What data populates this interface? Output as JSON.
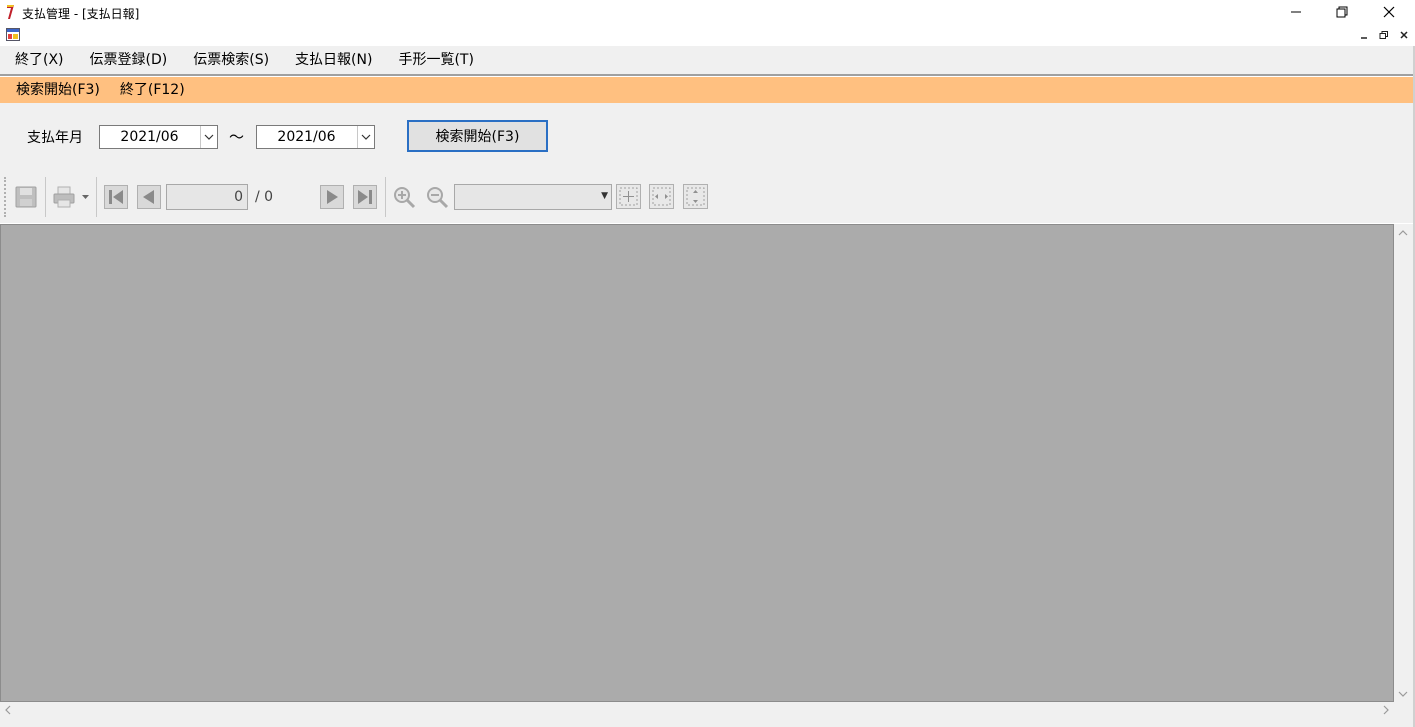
{
  "window": {
    "title": "支払管理 - [支払日報]",
    "controls": {
      "minimize": "—",
      "maximize": "❐",
      "close": "✕"
    }
  },
  "mdi": {
    "minimize": "_",
    "restore": "🗗",
    "close": "✕"
  },
  "menu": {
    "items": [
      {
        "label": "終了(X)"
      },
      {
        "label": "伝票登録(D)"
      },
      {
        "label": "伝票検索(S)"
      },
      {
        "label": "支払日報(N)"
      },
      {
        "label": "手形一覧(T)"
      }
    ]
  },
  "fkeys": {
    "items": [
      {
        "label": "検索開始(F3)"
      },
      {
        "label": "終了(F12)"
      }
    ],
    "background": "#ffc080"
  },
  "criteria": {
    "label": "支払年月",
    "from_value": "2021/06",
    "separator": "～",
    "to_value": "2021/06",
    "search_button": "検索開始(F3)",
    "accent": "#2a6fc4"
  },
  "toolbar": {
    "current_page": "0",
    "total_pages": "/ 0",
    "zoom_value": "",
    "icons": [
      "save-icon",
      "print-icon",
      "first-page-icon",
      "prev-page-icon",
      "next-page-icon",
      "last-page-icon",
      "zoom-in-icon",
      "zoom-out-icon",
      "fit-page-icon",
      "fit-width-icon",
      "fit-height-icon"
    ]
  },
  "viewer": {
    "background": "#ababab"
  }
}
